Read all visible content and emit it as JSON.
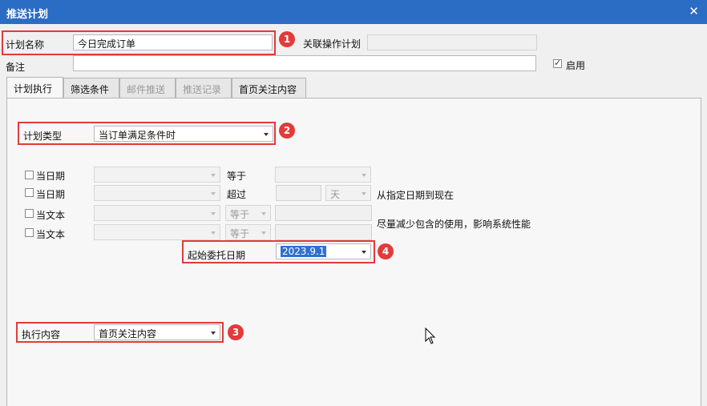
{
  "window": {
    "title": "推送计划",
    "close_icon": "close-icon"
  },
  "form": {
    "plan_name_label": "计划名称",
    "plan_name_value": "今日完成订单",
    "related_plan_label": "关联操作计划",
    "related_plan_value": "",
    "remark_label": "备注",
    "remark_value": "",
    "enable_label": "启用",
    "enable_checked": true
  },
  "tabs": [
    {
      "label": "计划执行",
      "state": "active"
    },
    {
      "label": "筛选条件",
      "state": "normal"
    },
    {
      "label": "邮件推送",
      "state": "disabled"
    },
    {
      "label": "推送记录",
      "state": "disabled"
    },
    {
      "label": "首页关注内容",
      "state": "normal"
    }
  ],
  "exec": {
    "plan_type_label": "计划类型",
    "plan_type_value": "当订单满足条件时",
    "cond_rows": [
      {
        "label": "当日期",
        "op": "等于"
      },
      {
        "label": "当日期",
        "op": "超过",
        "unit": "天",
        "note": "从指定日期到现在"
      },
      {
        "label": "当文本",
        "op": "等于",
        "note": "尽量减少包含的使用，影响系统性能"
      },
      {
        "label": "当文本",
        "op": "等于"
      }
    ],
    "start_date_label": "起始委托日期",
    "start_date_value": "2023.9.1",
    "exec_content_label": "执行内容",
    "exec_content_value": "首页关注内容"
  },
  "badges": [
    "1",
    "2",
    "3",
    "4"
  ],
  "colors": {
    "titlebar": "#2b6cc4",
    "highlight": "#e33a3a",
    "selection": "#2f6fd1"
  }
}
